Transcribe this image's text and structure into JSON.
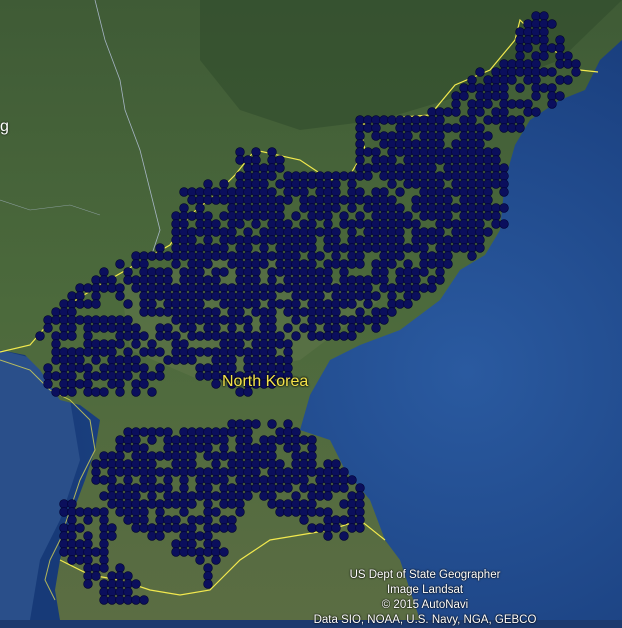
{
  "map": {
    "country_label": "North Korea",
    "edge_label": "g",
    "marker_color": "#0b0f5c",
    "marker_outline": "#000033",
    "border_color": "#f2e94e",
    "land_color": "#3e5a34",
    "sea_color": "#1f4a8c"
  },
  "attribution": {
    "line1": "US Dept of State Geographer",
    "line2": "Image Landsat",
    "line3": "© 2015 AutoNavi",
    "line4": "Data SIO, NOAA, U.S. Navy, NGA, GEBCO"
  }
}
